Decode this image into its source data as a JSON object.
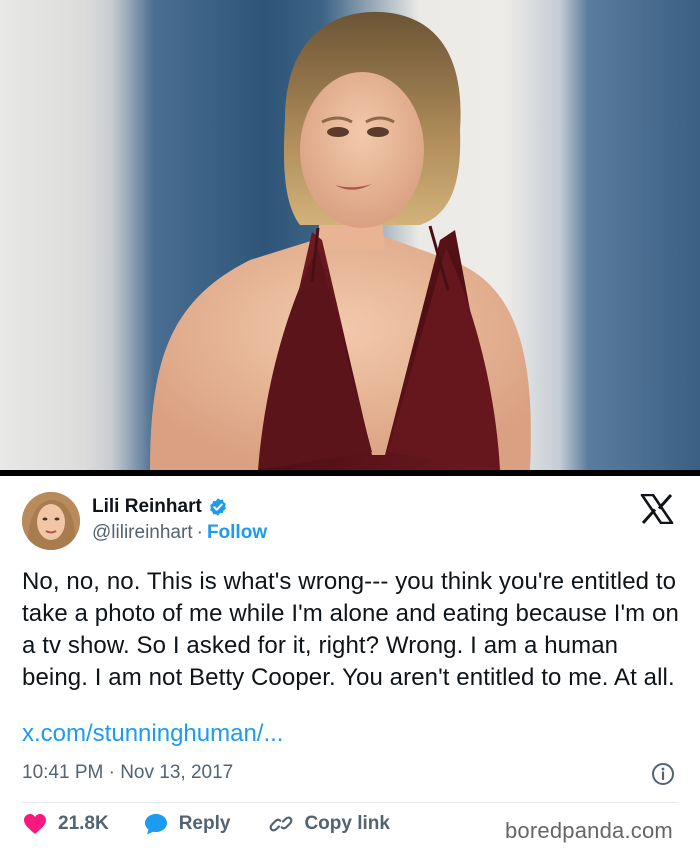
{
  "tweet": {
    "author_name": "Lili Reinhart",
    "handle": "@lilireinhart",
    "separator": "·",
    "follow_label": "Follow",
    "text": "No, no, no. This is what's wrong--- you think you're entitled to take a photo of me while I'm alone and eating because I'm on a tv show. So I asked for it, right? Wrong. I am a human being. I am not Betty Cooper. You aren't entitled to me. At all.",
    "link_text": "x.com/stunninghuman/...",
    "timestamp": "10:41 PM · Nov 13, 2017",
    "likes": "21.8K",
    "reply_label": "Reply",
    "copy_link_label": "Copy link"
  },
  "watermark": "boredpanda.com",
  "icons": {
    "verified": "verified-badge-icon",
    "x_logo": "x-logo-icon",
    "info": "info-icon",
    "heart": "heart-icon",
    "reply": "reply-bubble-icon",
    "link": "link-icon"
  },
  "colors": {
    "accent": "#1d9bf0",
    "heart": "#f91880",
    "text": "#0f1419",
    "secondary": "#536471"
  }
}
